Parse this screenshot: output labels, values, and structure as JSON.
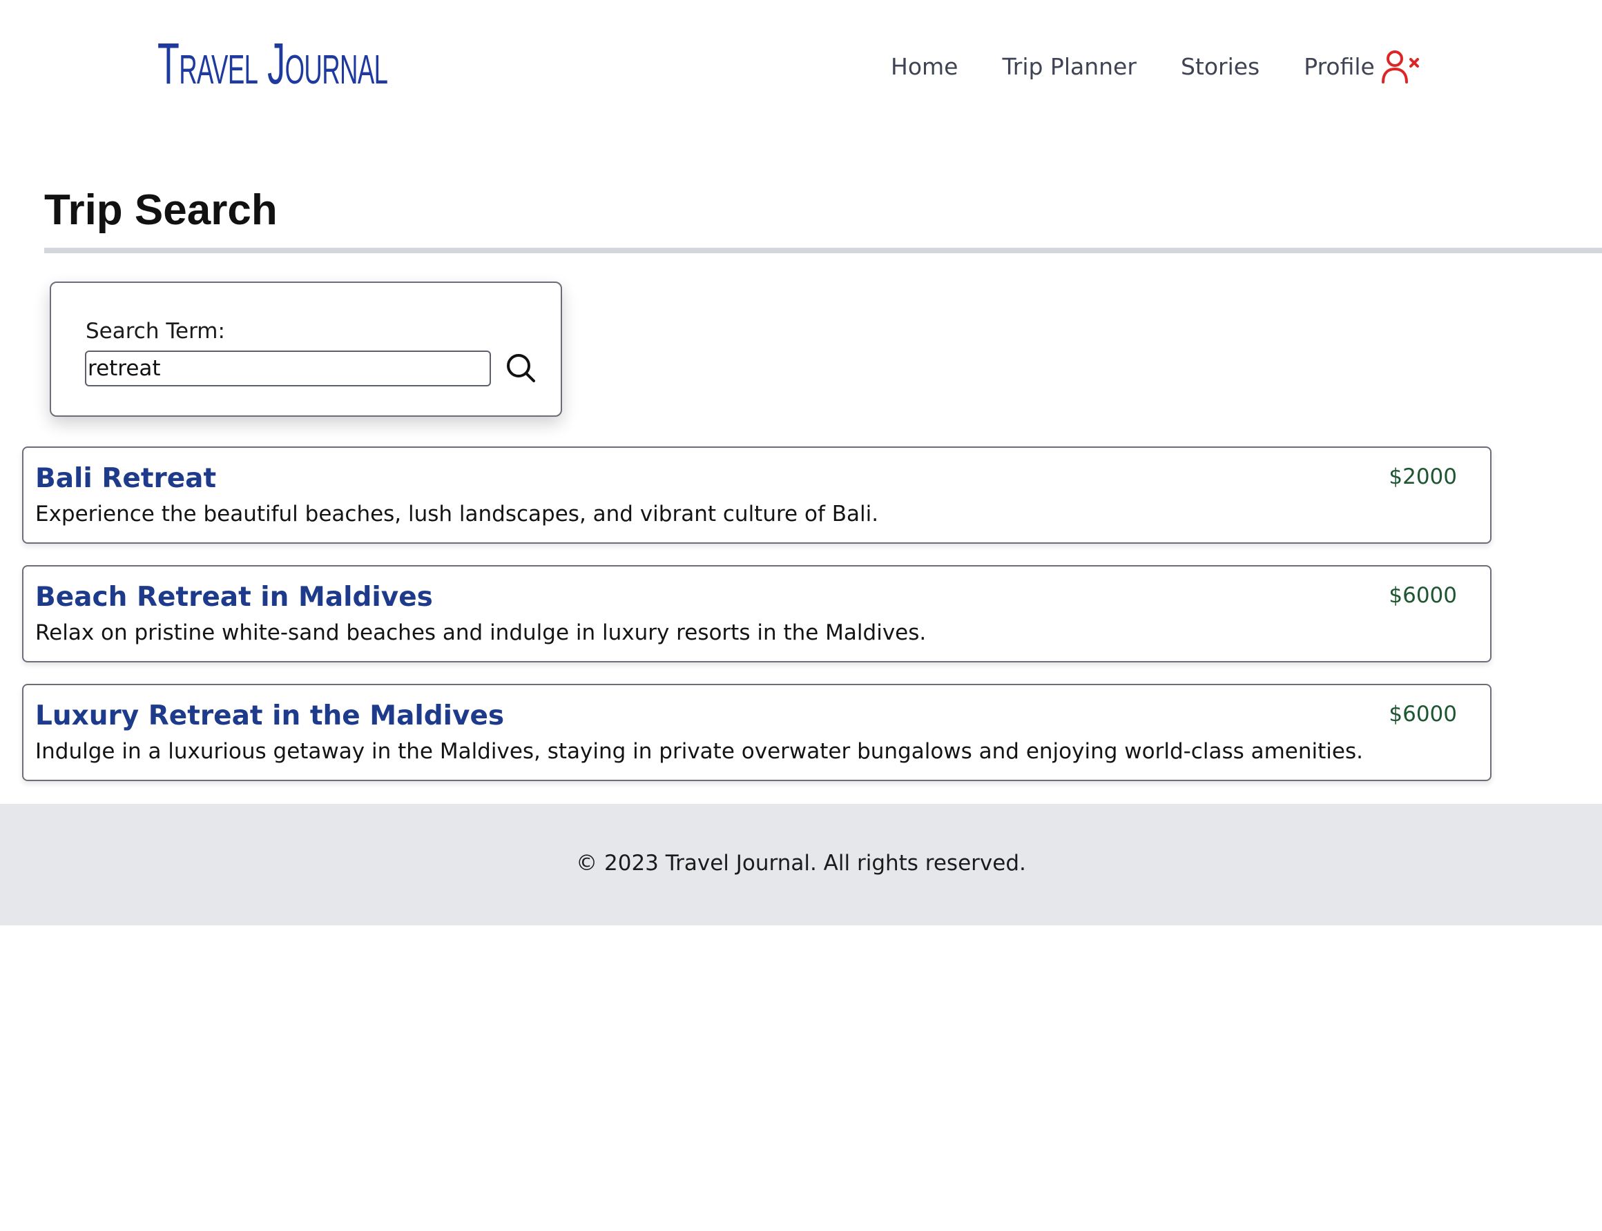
{
  "header": {
    "logo": "Travel Journal",
    "nav": [
      {
        "label": "Home"
      },
      {
        "label": "Trip Planner"
      },
      {
        "label": "Stories"
      },
      {
        "label": "Profile"
      }
    ],
    "logout_icon": "user-remove-icon"
  },
  "page": {
    "title": "Trip Search"
  },
  "search": {
    "label": "Search Term:",
    "value": "retreat",
    "button_icon": "search-icon"
  },
  "results": [
    {
      "title": "Bali Retreat",
      "description": "Experience the beautiful beaches, lush landscapes, and vibrant culture of Bali.",
      "price": "$2000"
    },
    {
      "title": "Beach Retreat in Maldives",
      "description": "Relax on pristine white-sand beaches and indulge in luxury resorts in the Maldives.",
      "price": "$6000"
    },
    {
      "title": "Luxury Retreat in the Maldives",
      "description": "Indulge in a luxurious getaway in the Maldives, staying in private overwater bungalows and enjoying world-class amenities.",
      "price": "$6000"
    }
  ],
  "footer": {
    "text": "© 2023 Travel Journal. All rights reserved."
  },
  "colors": {
    "brand": "#1e3a9f",
    "result_title": "#1e3a8a",
    "price": "#1e5631",
    "logout_icon": "#dc2626",
    "footer_bg": "#e5e7eb"
  }
}
